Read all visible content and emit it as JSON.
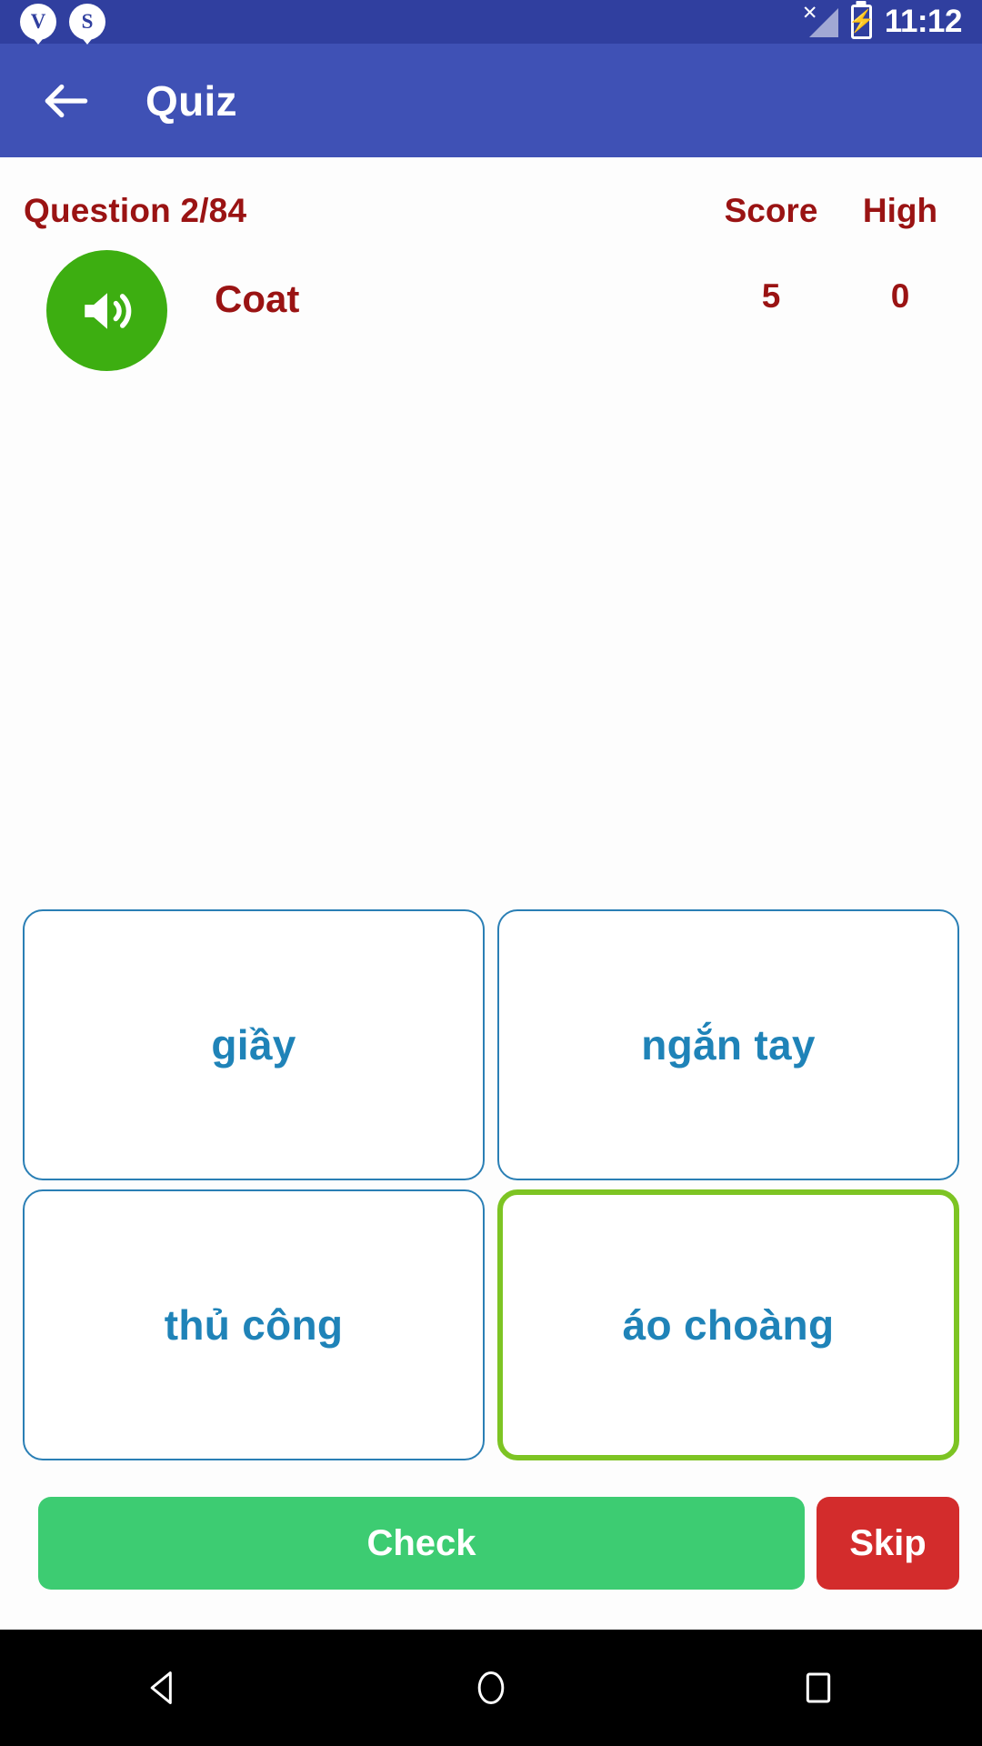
{
  "status_bar": {
    "notifications": [
      {
        "icon": "notification-badge-v-icon",
        "letter": "V"
      },
      {
        "icon": "notification-badge-s-icon",
        "letter": "S"
      }
    ],
    "signal_icon": "signal-no-service-icon",
    "signal_x": "✕",
    "battery_icon": "battery-charging-icon",
    "battery_glyph": "⚡",
    "time": "11:12",
    "background_color": "#303F9F"
  },
  "app_bar": {
    "back_icon": "back-arrow-icon",
    "title": "Quiz",
    "background_color": "#3F51B5"
  },
  "quiz": {
    "question_label": "Question 2/84",
    "score_label": "Score",
    "high_label": "High",
    "score_value": "5",
    "high_value": "0",
    "prompt_word": "Coat",
    "speaker_icon": "speaker-volume-icon",
    "speaker_color": "#3DAE11",
    "accent_text_color": "#9A1313",
    "option_text_color": "#1F83B8",
    "option_border_color": "#2A7FB5",
    "selected_border_color": "#7DC423",
    "options": [
      {
        "label": "giầy",
        "selected": false
      },
      {
        "label": "ngắn tay",
        "selected": false
      },
      {
        "label": "thủ công",
        "selected": false
      },
      {
        "label": "áo choàng",
        "selected": true
      }
    ]
  },
  "actions": {
    "check_label": "Check",
    "check_color": "#3DCC72",
    "skip_label": "Skip",
    "skip_color": "#D32C2C"
  },
  "nav_bar": {
    "back_icon": "android-back-icon",
    "home_icon": "android-home-icon",
    "recents_icon": "android-recents-icon",
    "background_color": "#000000"
  }
}
